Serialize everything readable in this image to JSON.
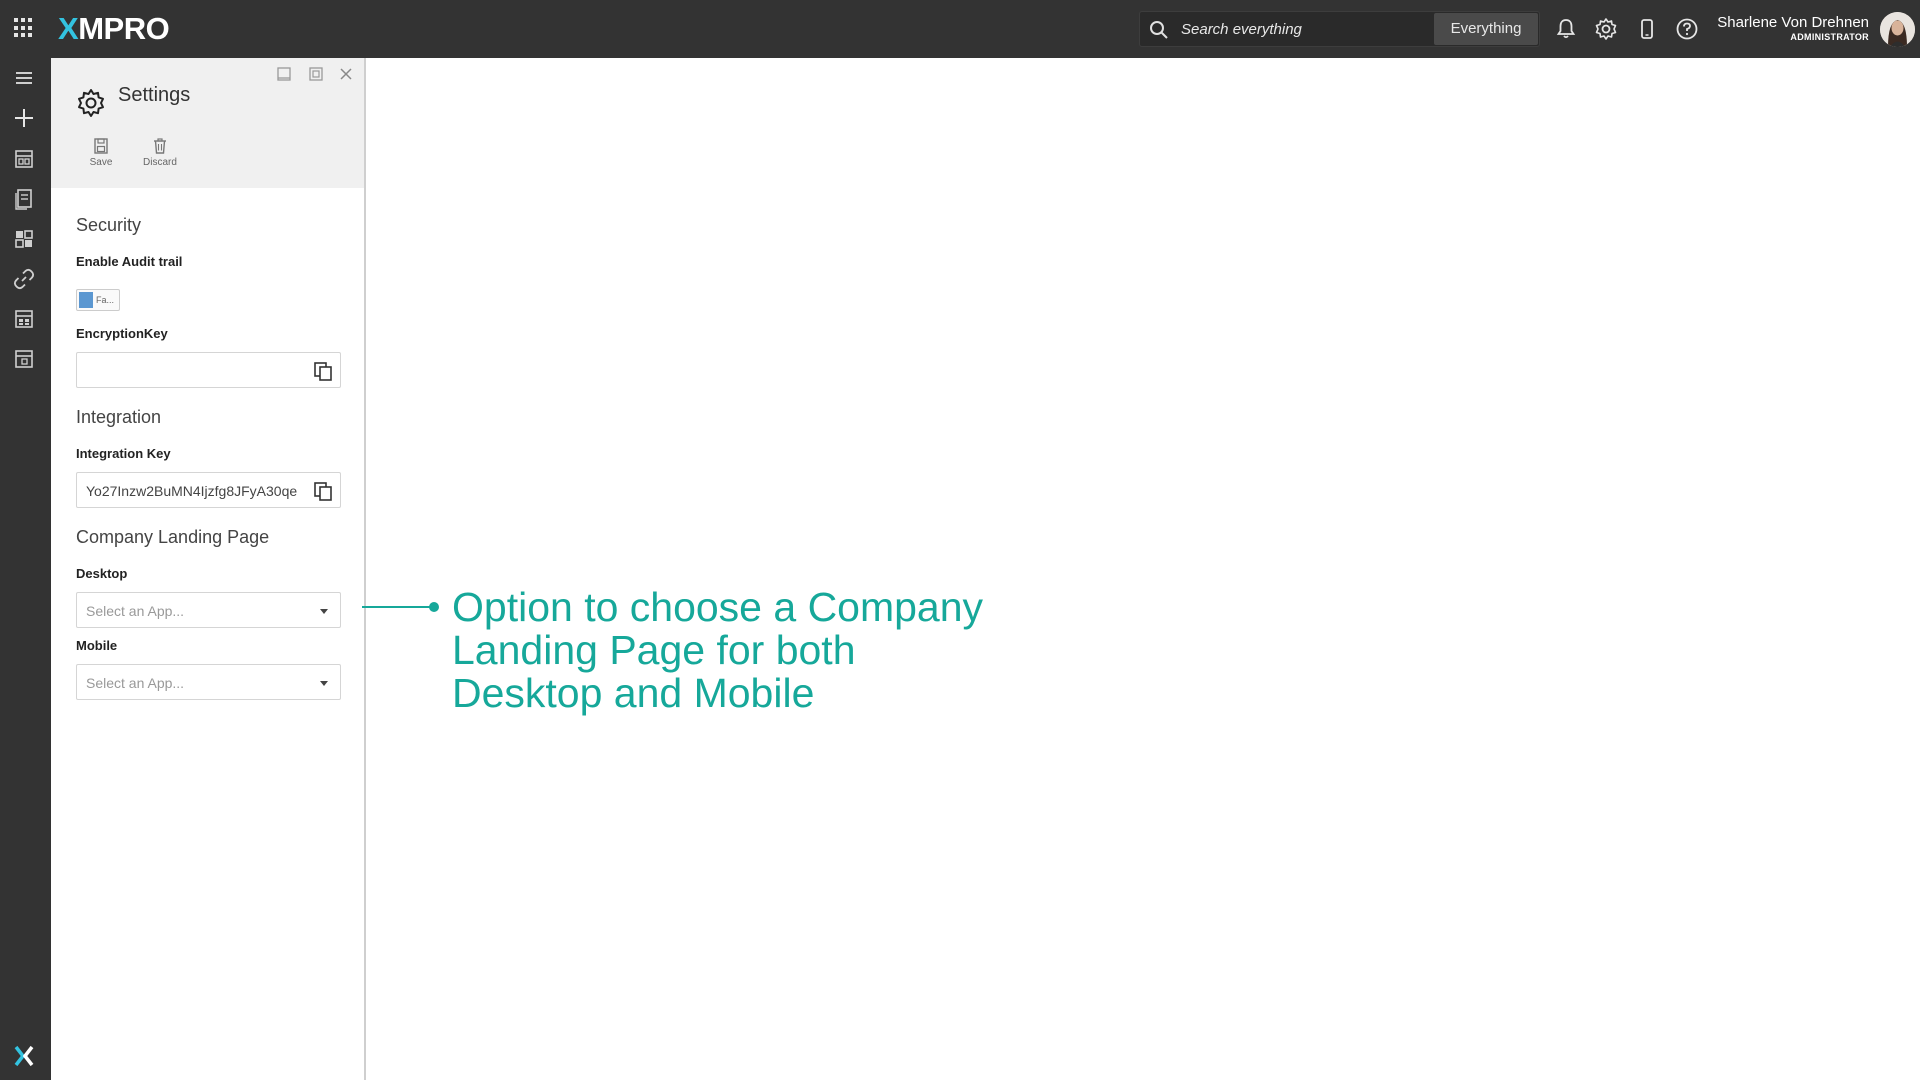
{
  "app": {
    "logo_text": "MPRO",
    "logo_prefix": "X",
    "accent_color": "#16a89a",
    "brand_color": "#33c3e0"
  },
  "topbar": {
    "search_placeholder": "Search everything",
    "search_scope": "Everything",
    "icons": [
      "grid-icon",
      "bell-icon",
      "gear-icon",
      "mobile-icon",
      "help-icon"
    ],
    "user": {
      "name": "Sharlene Von Drehnen",
      "role": "ADMINISTRATOR"
    }
  },
  "rail": {
    "items": [
      "menu-icon",
      "plus-icon",
      "recent-apps-icon",
      "data-streams-icon",
      "dashboard-icon",
      "connection-icon",
      "app-designer-icon",
      "template-icon"
    ]
  },
  "panel": {
    "title": "Settings",
    "actions": {
      "save": "Save",
      "discard": "Discard"
    },
    "security": {
      "heading": "Security",
      "audit_label": "Enable Audit trail",
      "audit_toggle_text": "Fa...",
      "encryption_label": "EncryptionKey",
      "encryption_value": ""
    },
    "integration": {
      "heading": "Integration",
      "key_label": "Integration Key",
      "key_value": "Yo27Inzw2BuMN4Ijzfg8JFyA30qe"
    },
    "landing": {
      "heading": "Company Landing Page",
      "desktop_label": "Desktop",
      "desktop_placeholder": "Select an App...",
      "mobile_label": "Mobile",
      "mobile_placeholder": "Select an App..."
    }
  },
  "annotation": {
    "text": "Option to choose a Company Landing Page for both Desktop and Mobile"
  }
}
